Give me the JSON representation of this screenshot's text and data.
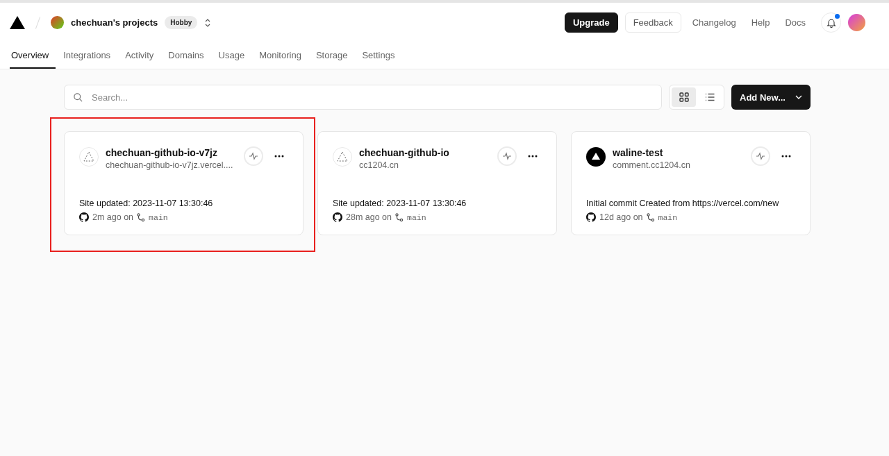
{
  "header": {
    "team": "chechuan's projects",
    "plan": "Hobby",
    "actions": [
      {
        "label": "Upgrade",
        "kind": "primary"
      },
      {
        "label": "Feedback",
        "kind": "outline"
      },
      {
        "label": "Changelog",
        "kind": "link"
      },
      {
        "label": "Help",
        "kind": "link"
      },
      {
        "label": "Docs",
        "kind": "link"
      }
    ],
    "notifications_unread": true
  },
  "tabs": [
    {
      "label": "Overview",
      "selected": true
    },
    {
      "label": "Integrations",
      "selected": false
    },
    {
      "label": "Activity",
      "selected": false
    },
    {
      "label": "Domains",
      "selected": false
    },
    {
      "label": "Usage",
      "selected": false
    },
    {
      "label": "Monitoring",
      "selected": false
    },
    {
      "label": "Storage",
      "selected": false
    },
    {
      "label": "Settings",
      "selected": false
    }
  ],
  "search": {
    "placeholder": "Search..."
  },
  "view_toggle": [
    {
      "kind": "grid",
      "selected": true
    },
    {
      "kind": "list",
      "selected": false
    }
  ],
  "add_button": "Add New...",
  "projects": [
    {
      "name": "chechuan-github-io-v7jz",
      "domain": "chechuan-github-io-v7jz.vercel....",
      "kind": "placeholder",
      "message": "Site updated: 2023-11-07 13:30:46",
      "time": "2m ago on",
      "branch": "main",
      "highlighted": true
    },
    {
      "name": "chechuan-github-io",
      "domain": "cc1204.cn",
      "kind": "placeholder",
      "message": "Site updated: 2023-11-07 13:30:46",
      "time": "28m ago on",
      "branch": "main",
      "highlighted": false
    },
    {
      "name": "waline-test",
      "domain": "comment.cc1204.cn",
      "kind": "logo",
      "message": "Initial commit Created from https://vercel.com/new",
      "time": "12d ago on",
      "branch": "main",
      "highlighted": false
    }
  ]
}
